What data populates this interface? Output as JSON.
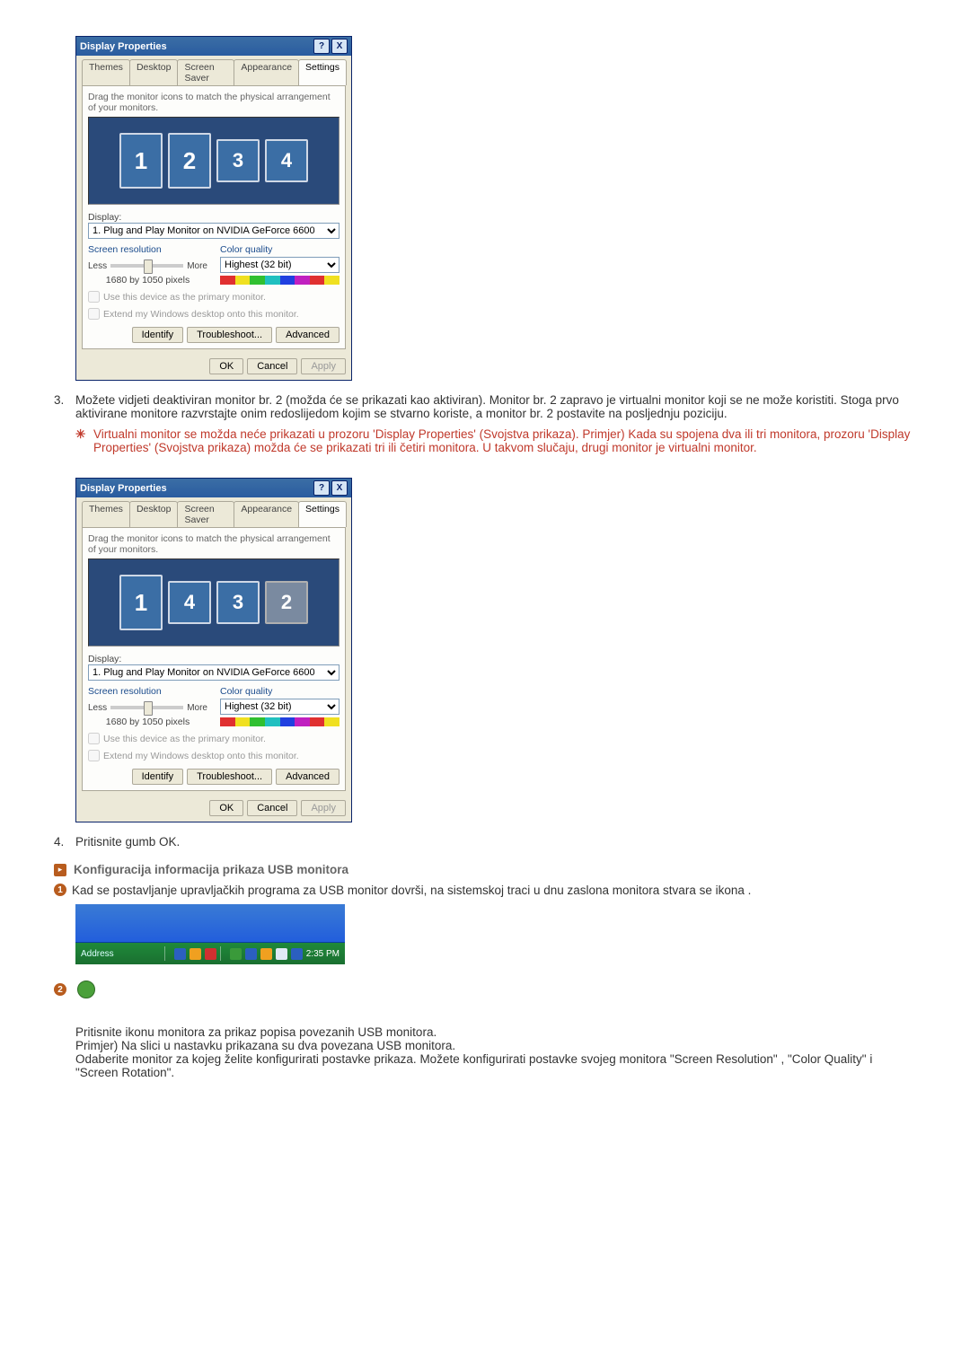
{
  "dlg": {
    "title": "Display Properties",
    "tabs": [
      "Themes",
      "Desktop",
      "Screen Saver",
      "Appearance",
      "Settings"
    ],
    "activeTab": "Settings",
    "helpBtn": "?",
    "closeBtn": "X",
    "hint": "Drag the monitor icons to match the physical arrangement of your monitors.",
    "displayLabel": "Display:",
    "displayCombo": "1. Plug and Play Monitor on NVIDIA GeForce 6600",
    "screenRes": {
      "title": "Screen resolution",
      "less": "Less",
      "more": "More",
      "value": "1680 by 1050 pixels"
    },
    "colorQuality": {
      "title": "Color quality",
      "value": "Highest (32 bit)"
    },
    "chk1": "Use this device as the primary monitor.",
    "chk2": "Extend my Windows desktop onto this monitor.",
    "btnIdentify": "Identify",
    "btnTroubleshoot": "Troubleshoot...",
    "btnAdvanced": "Advanced",
    "btnOK": "OK",
    "btnCancel": "Cancel",
    "btnApply": "Apply",
    "arrange1": [
      "1",
      "2",
      "3",
      "4"
    ],
    "arrange2": [
      "1",
      "4",
      "3",
      "2"
    ]
  },
  "steps": {
    "s3num": "3.",
    "s3text": "Možete vidjeti deaktiviran monitor br. 2 (možda će se prikazati kao aktiviran). Monitor br. 2 zapravo je virtualni monitor koji se ne može koristiti. Stoga prvo aktivirane monitore razvrstajte onim redoslijedom kojim se stvarno koriste, a monitor br. 2 postavite na posljednju poziciju.",
    "s3noteIcon": "✳",
    "s3note": "Virtualni monitor se možda neće prikazati u prozoru 'Display Properties' (Svojstva prikaza). Primjer) Kada su spojena dva ili tri monitora, prozoru 'Display Properties' (Svojstva prikaza) možda će se prikazati tri ili četiri monitora. U takvom slučaju, drugi monitor je virtualni monitor.",
    "s4num": "4.",
    "s4text": "Pritisnite gumb OK."
  },
  "section": {
    "bullet": "▸",
    "title": "Konfiguracija informacija prikaza USB monitora",
    "badge1": "1",
    "p1": "Kad se postavljanje upravljačkih programa za USB monitor dovrši, na sistemskoj traci u dnu zaslona monitora stvara se ikona .",
    "badge2": "2",
    "p2a": "Pritisnite ikonu monitora za prikaz popisa povezanih USB monitora.",
    "p2b": "Primjer) Na slici u nastavku prikazana su dva povezana USB monitora.",
    "p2c": "Odaberite monitor za kojeg želite konfigurirati postavke prikaza. Možete konfigurirati postavke svojeg monitora \"Screen Resolution\" , \"Color Quality\" i \"Screen Rotation\"."
  },
  "tray": {
    "addressLabel": "Address",
    "time": "2:35 PM"
  }
}
